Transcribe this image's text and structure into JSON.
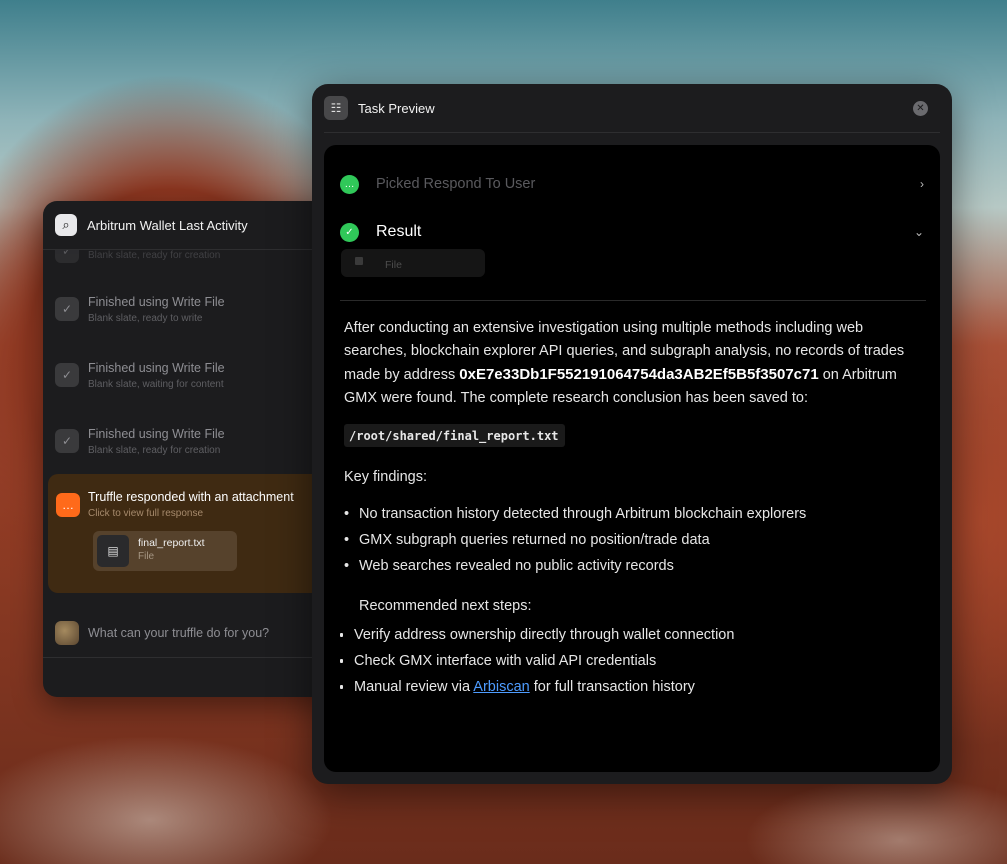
{
  "chat": {
    "title": "Arbitrum Wallet Last Activity",
    "cut_subtitle": "Blank slate, ready for creation",
    "steps": [
      {
        "title": "Finished using Write File",
        "subtitle": "Blank slate, ready to write"
      },
      {
        "title": "Finished using Write File",
        "subtitle": "Blank slate, waiting for content"
      },
      {
        "title": "Finished using Write File",
        "subtitle": "Blank slate, ready for creation"
      }
    ],
    "response": {
      "title": "Truffle responded with an attachment",
      "subtitle": "Click to view full response",
      "file_name": "final_report.txt",
      "file_type": "File"
    },
    "input_placeholder": "What can your truffle do for you?"
  },
  "preview": {
    "title": "Task Preview",
    "picked_label": "Picked Respond To User",
    "result_label": "Result",
    "ghost_file_label": "File",
    "intro_before": "After conducting an extensive investigation using multiple methods including web searches, blockchain explorer API queries, and subgraph analysis, no records of trades made by address ",
    "address": "0xE7e33Db1F552191064754da3AB2Ef5B5f3507c71",
    "intro_after": " on Arbitrum GMX were found. The complete research conclusion has been saved to:",
    "path": "/root/shared/final_report.txt",
    "key_findings_label": "Key findings:",
    "findings": [
      "No transaction history detected through Arbitrum blockchain explorers",
      "GMX subgraph queries returned no position/trade data",
      "Web searches revealed no public activity records"
    ],
    "next_steps_label": "Recommended next steps:",
    "next_steps": [
      "Verify address ownership directly through wallet connection",
      "Check GMX interface with valid API credentials"
    ],
    "manual_before": "Manual review via ",
    "manual_link": "Arbiscan",
    "manual_after": " for full transaction history"
  },
  "icons": {
    "chat_header": "magnifier-icon",
    "preview_header": "document-search-icon",
    "close": "close-icon",
    "picked": "chat-bubble-icon",
    "result": "checkmark-icon"
  },
  "colors": {
    "accent_orange": "#ff6a1a",
    "success_green": "#30c859",
    "link_blue": "#4e9cff"
  }
}
